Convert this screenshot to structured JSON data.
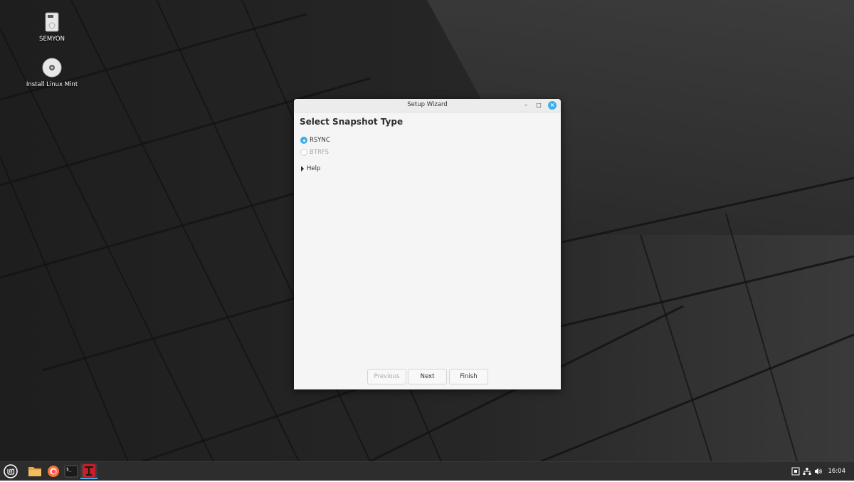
{
  "desktop": {
    "icons": [
      {
        "label": "SEMYON"
      },
      {
        "label": "Install Linux Mint"
      }
    ]
  },
  "dialog": {
    "title": "Setup Wizard",
    "heading": "Select Snapshot Type",
    "options": [
      {
        "label": "RSYNC",
        "selected": true,
        "enabled": true
      },
      {
        "label": "BTRFS",
        "selected": false,
        "enabled": false
      }
    ],
    "help_label": "Help",
    "buttons": {
      "previous": "Previous",
      "next": "Next",
      "finish": "Finish"
    }
  },
  "panel": {
    "launchers": [
      "mint-menu-icon",
      "folder-icon",
      "firefox-icon",
      "terminal-icon",
      "timeshift-icon"
    ],
    "tray_icons": [
      "keyboard-icon",
      "network-icon",
      "volume-icon"
    ],
    "clock": "16:04"
  },
  "colors": {
    "accent": "#3daee9",
    "panel": "#2d2d2d",
    "dialog_bg": "#f5f5f5"
  }
}
